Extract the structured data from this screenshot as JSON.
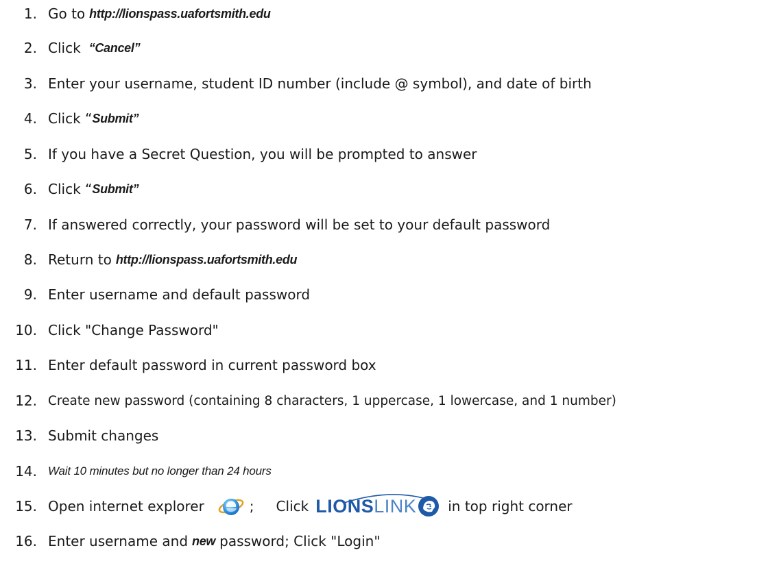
{
  "steps": [
    {
      "num": "1.",
      "pre": "Go to",
      "em": "http://lionspass.uafortsmith.edu"
    },
    {
      "num": "2.",
      "pre": "Click",
      "em": "“Cancel”"
    },
    {
      "num": "3.",
      "text": "Enter your username, student ID number (include @ symbol), and date of birth"
    },
    {
      "num": "4.",
      "pre": "Click “",
      "em": "Submit”"
    },
    {
      "num": "5.",
      "text": "If you have a Secret Question, you will be prompted to answer"
    },
    {
      "num": "6.",
      "pre": "Click “",
      "em": "Submit”"
    },
    {
      "num": "7.",
      "text": "If answered correctly, your password will be set to your default password"
    },
    {
      "num": "8.",
      "pre": "Return to",
      "em": "http://lionspass.uafortsmith.edu"
    },
    {
      "num": "9.",
      "text": "Enter username and default password"
    },
    {
      "num": "10.",
      "text": "Click \"Change Password\""
    },
    {
      "num": "11.",
      "text": "Enter default password in current password box"
    },
    {
      "num": "12.",
      "text": "Create new password (containing 8 characters, 1 uppercase, 1 lowercase, and 1 number)"
    },
    {
      "num": "13.",
      "text": "Submit changes"
    },
    {
      "num": "14.",
      "italic": "Wait 10 minutes but no longer than 24 hours"
    },
    {
      "num": "15.",
      "pre": "Open internet explorer",
      "semi": ";",
      "click": "Click",
      "logo_a": "LIONS",
      "logo_b": "LINK",
      "post": "in top right corner"
    },
    {
      "num": "16.",
      "pre": "Enter username and",
      "em": "new",
      "post": "password; Click \"Login\""
    }
  ],
  "icons": {
    "browser": "internet-explorer-icon",
    "logo": "lionslink-logo",
    "lion": "lion-head-icon"
  },
  "colors": {
    "text": "#1a1a1a",
    "logo_dark_blue": "#1f5aa8",
    "logo_light_blue": "#4c84c8"
  }
}
